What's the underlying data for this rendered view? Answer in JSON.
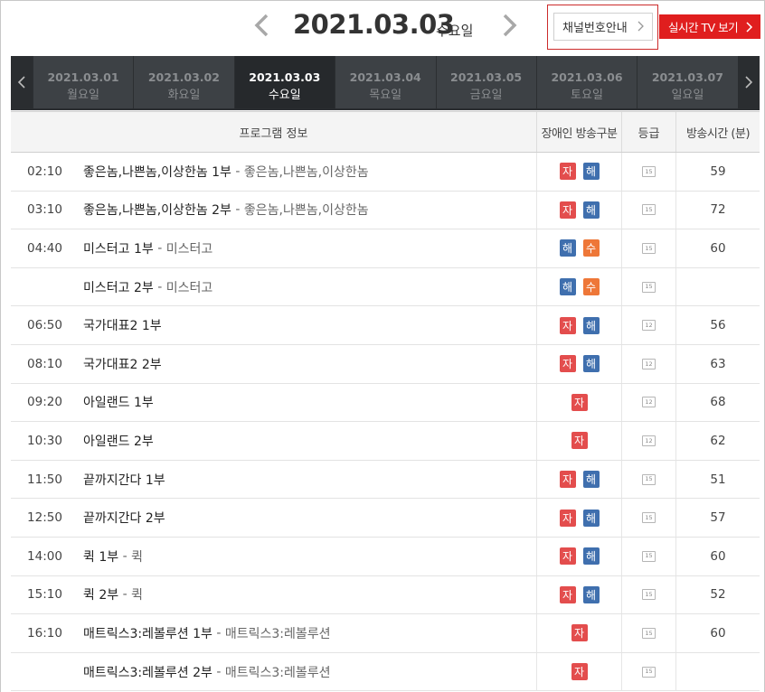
{
  "header": {
    "date": "2021.03.03",
    "weekday": "수요일",
    "channel_guide_label": "채널번호안내",
    "live_tv_label": "실시간 TV 보기"
  },
  "tabs": [
    {
      "date": "2021.03.01",
      "weekday": "월요일",
      "active": false
    },
    {
      "date": "2021.03.02",
      "weekday": "화요일",
      "active": false
    },
    {
      "date": "2021.03.03",
      "weekday": "수요일",
      "active": true
    },
    {
      "date": "2021.03.04",
      "weekday": "목요일",
      "active": false
    },
    {
      "date": "2021.03.05",
      "weekday": "금요일",
      "active": false
    },
    {
      "date": "2021.03.06",
      "weekday": "토요일",
      "active": false
    },
    {
      "date": "2021.03.07",
      "weekday": "일요일",
      "active": false
    }
  ],
  "table": {
    "headers": {
      "program": "프로그램 정보",
      "accessibility": "장애인 방송구분",
      "grade": "등급",
      "duration": "방송시간 (분)"
    },
    "rows": [
      {
        "time": "02:10",
        "title": "좋은놈,나쁜놈,이상한놈 1부",
        "subtitle": "좋은놈,나쁜놈,이상한놈",
        "badges": [
          "자",
          "해"
        ],
        "grade": "15",
        "duration": "59"
      },
      {
        "time": "03:10",
        "title": "좋은놈,나쁜놈,이상한놈 2부",
        "subtitle": "좋은놈,나쁜놈,이상한놈",
        "badges": [
          "자",
          "해"
        ],
        "grade": "15",
        "duration": "72"
      },
      {
        "time": "04:40",
        "title": "미스터고 1부",
        "subtitle": "미스터고",
        "badges": [
          "해",
          "수"
        ],
        "grade": "15",
        "duration": "60"
      },
      {
        "time": "",
        "title": "미스터고 2부",
        "subtitle": "미스터고",
        "badges": [
          "해",
          "수"
        ],
        "grade": "15",
        "duration": ""
      },
      {
        "time": "06:50",
        "title": "국가대표2 1부",
        "subtitle": "",
        "badges": [
          "자",
          "해"
        ],
        "grade": "12",
        "duration": "56"
      },
      {
        "time": "08:10",
        "title": "국가대표2 2부",
        "subtitle": "",
        "badges": [
          "자",
          "해"
        ],
        "grade": "12",
        "duration": "63"
      },
      {
        "time": "09:20",
        "title": "아일랜드 1부",
        "subtitle": "",
        "badges": [
          "자"
        ],
        "grade": "12",
        "duration": "68"
      },
      {
        "time": "10:30",
        "title": "아일랜드 2부",
        "subtitle": "",
        "badges": [
          "자"
        ],
        "grade": "12",
        "duration": "62"
      },
      {
        "time": "11:50",
        "title": "끝까지간다 1부",
        "subtitle": "",
        "badges": [
          "자",
          "해"
        ],
        "grade": "15",
        "duration": "51"
      },
      {
        "time": "12:50",
        "title": "끝까지간다 2부",
        "subtitle": "",
        "badges": [
          "자",
          "해"
        ],
        "grade": "15",
        "duration": "57"
      },
      {
        "time": "14:00",
        "title": "퀵 1부",
        "subtitle": "퀵",
        "badges": [
          "자",
          "해"
        ],
        "grade": "15",
        "duration": "60"
      },
      {
        "time": "15:10",
        "title": "퀵 2부",
        "subtitle": "퀵",
        "badges": [
          "자",
          "해"
        ],
        "grade": "15",
        "duration": "52"
      },
      {
        "time": "16:10",
        "title": "매트릭스3:레볼루션 1부",
        "subtitle": "매트릭스3:레볼루션",
        "badges": [
          "자"
        ],
        "grade": "15",
        "duration": "60"
      },
      {
        "time": "",
        "title": "매트릭스3:레볼루션 2부",
        "subtitle": "매트릭스3:레볼루션",
        "badges": [
          "자"
        ],
        "grade": "15",
        "duration": ""
      }
    ]
  },
  "badge_colors": {
    "자": "#e34d4d",
    "해": "#3f6fae",
    "수": "#ee7738"
  },
  "icons": {
    "prev": "chevron-left-icon",
    "next": "chevron-right-icon"
  }
}
